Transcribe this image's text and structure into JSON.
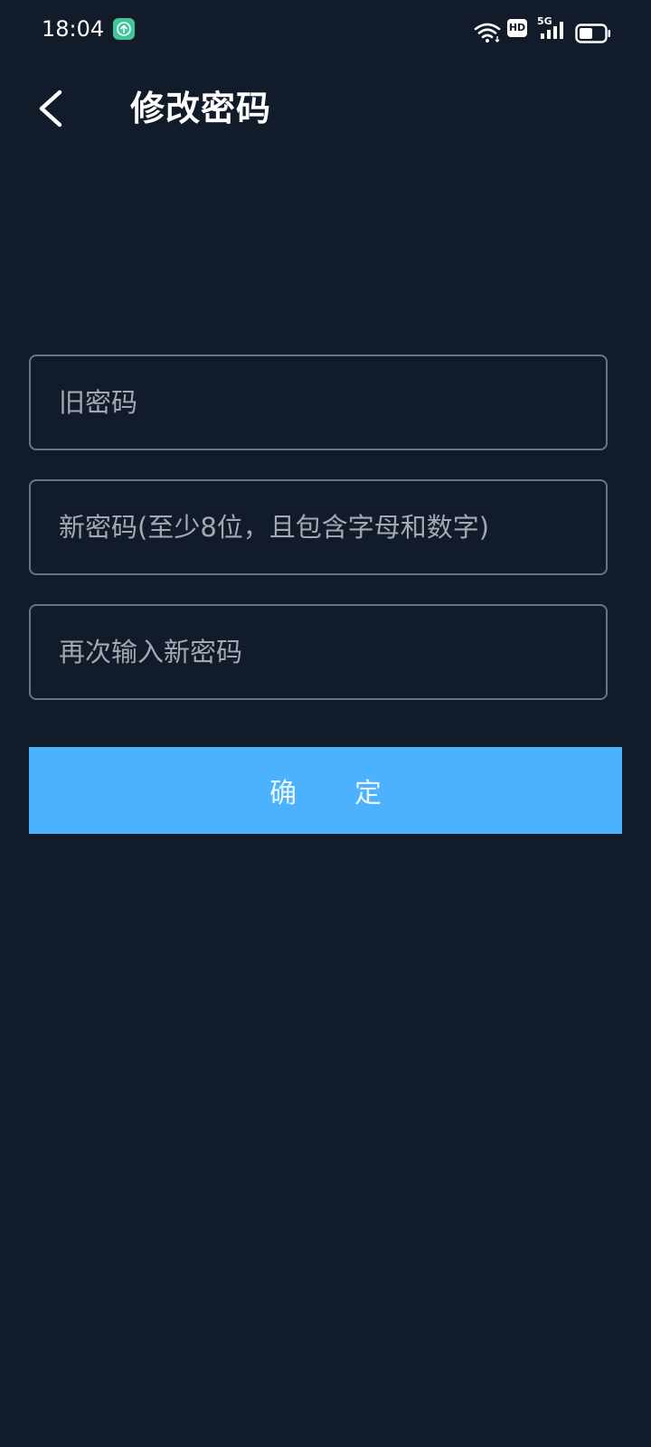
{
  "status_bar": {
    "time": "18:04",
    "network_badge": "HD",
    "network_type": "5G",
    "icons": [
      "app-notification-icon",
      "wifi-icon",
      "hd-icon",
      "signal-5g-icon",
      "battery-icon"
    ]
  },
  "header": {
    "title": "修改密码",
    "back_icon": "chevron-left-icon"
  },
  "form": {
    "old_password": {
      "placeholder": "旧密码",
      "value": ""
    },
    "new_password": {
      "placeholder": "新密码(至少8位，且包含字母和数字)",
      "value": ""
    },
    "confirm_password": {
      "placeholder": "再次输入新密码",
      "value": ""
    },
    "submit_label": "确定"
  },
  "colors": {
    "background": "#111b2a",
    "input_border": "#6b7482",
    "placeholder": "#a3a9b2",
    "button": "#4db2fd",
    "notification_badge": "#3fc79a"
  }
}
